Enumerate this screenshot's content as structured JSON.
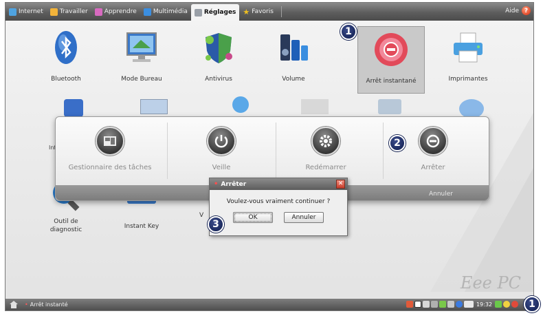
{
  "tabs": [
    {
      "label": "Internet",
      "color": "#4fa3e0"
    },
    {
      "label": "Travailler",
      "color": "#f2b33a"
    },
    {
      "label": "Apprendre",
      "color": "#d86ac0"
    },
    {
      "label": "Multimédia",
      "color": "#3b8ee0"
    },
    {
      "label": "Réglages",
      "color": "#888888",
      "active": true
    },
    {
      "label": "Favoris",
      "color": "#f0c020"
    }
  ],
  "help_label": "Aide",
  "apps_row1": [
    {
      "label": "Bluetooth",
      "icon": "bluetooth-icon"
    },
    {
      "label": "Mode Bureau",
      "icon": "desktop-mode-icon"
    },
    {
      "label": "Antivirus",
      "icon": "antivirus-shield-icon"
    },
    {
      "label": "Volume",
      "icon": "volume-icon"
    },
    {
      "label": "Arrêt instantané",
      "icon": "instant-shutdown-icon",
      "selected": true
    },
    {
      "label": "Imprimantes",
      "icon": "printer-icon"
    }
  ],
  "apps_row3": [
    {
      "label": "Outil de diagnostic",
      "icon": "diagnostic-tool-icon"
    },
    {
      "label": "Instant Key",
      "icon": "instant-key-icon"
    }
  ],
  "shutdown_panel": {
    "buttons": [
      {
        "label": "Gestionnaire des tâches",
        "icon": "task-manager-icon"
      },
      {
        "label": "Veille",
        "icon": "power-icon"
      },
      {
        "label": "Redémarrer",
        "icon": "restart-gear-icon"
      },
      {
        "label": "Arrêter",
        "icon": "shutdown-minus-icon"
      }
    ],
    "cancel_label": "Annuler"
  },
  "dialog": {
    "title": "Arrêter",
    "message": "Voulez-vous vraiment continuer ?",
    "ok_label": "OK",
    "cancel_label": "Annuler"
  },
  "callouts": [
    "1",
    "2",
    "3",
    "1"
  ],
  "brand": "Eee PC",
  "taskbar": {
    "task_label": "Arrêt instanté",
    "clock": "19:32"
  },
  "colors": {
    "callout": "#0e1c4d",
    "accent_red": "#d62a0a"
  }
}
